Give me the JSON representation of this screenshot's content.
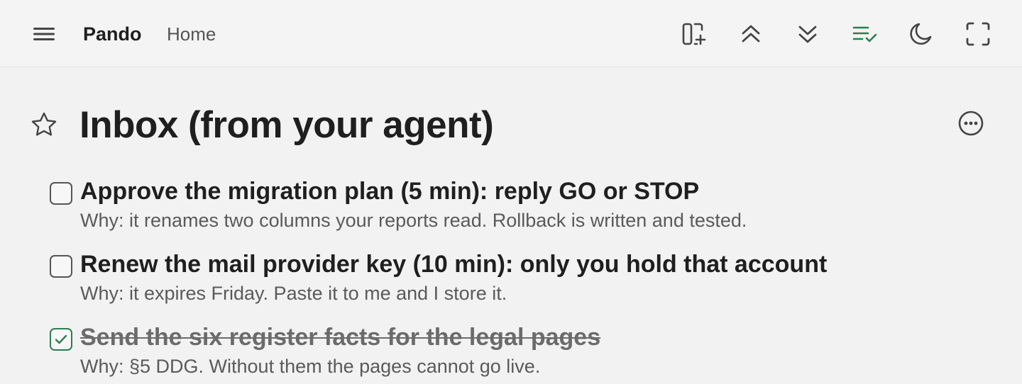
{
  "header": {
    "brand": "Pando",
    "breadcrumb": "Home",
    "icons": {
      "menu": "menu-icon",
      "tools": [
        "add-panel-icon",
        "collapse-all-icon",
        "expand-all-icon",
        "show-completed-icon",
        "dark-mode-icon",
        "fullscreen-icon"
      ]
    },
    "colors": {
      "active_tool": "#2e7d4f"
    }
  },
  "page": {
    "title": "Inbox (from your agent)",
    "icons": {
      "favorite": "star-icon",
      "more": "more-options-icon"
    }
  },
  "tasks": [
    {
      "title": "Approve the migration plan (5 min): reply GO or STOP",
      "note": "Why: it renames two columns your reports read. Rollback is written and tested.",
      "checked": false
    },
    {
      "title": "Renew the mail provider key (10 min): only you hold that account",
      "note": "Why: it expires Friday. Paste it to me and I store it.",
      "checked": false
    },
    {
      "title": "Send the six register facts for the legal pages",
      "note": "Why: §5 DDG. Without them the pages cannot go live.",
      "checked": true
    }
  ]
}
